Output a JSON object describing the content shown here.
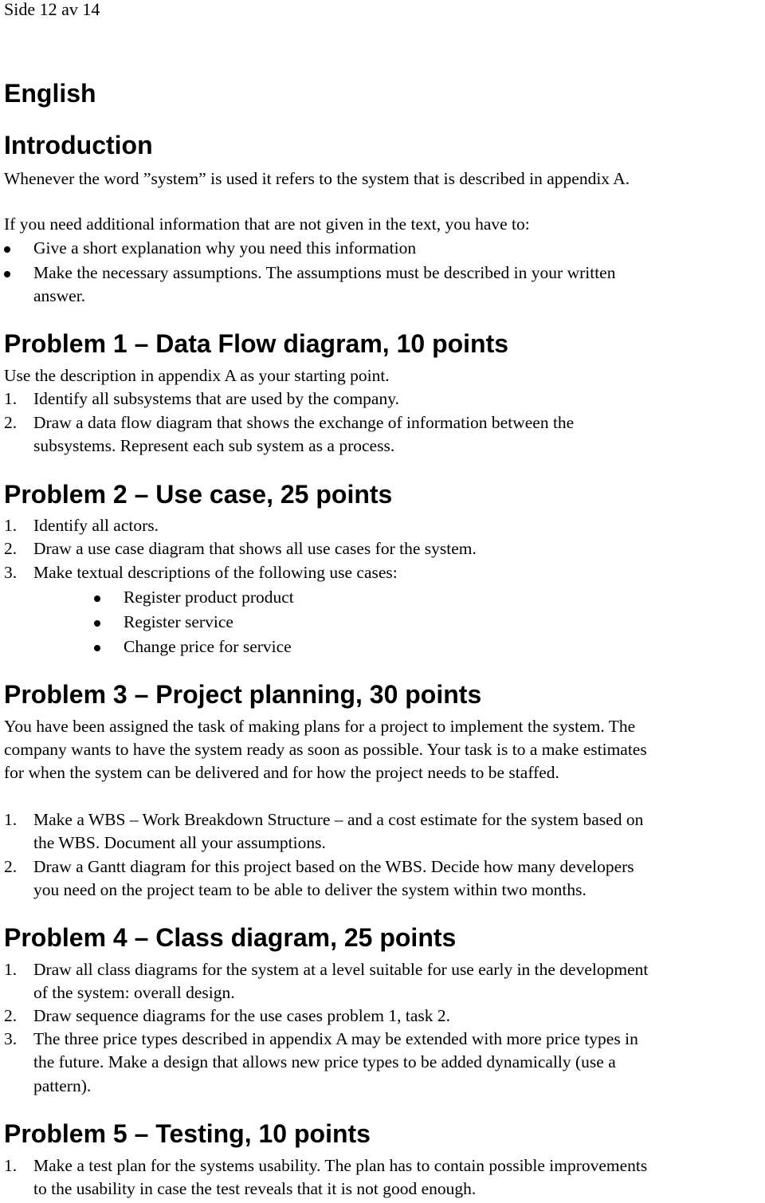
{
  "page_header": "Side 12 av 14",
  "language_heading": "English",
  "introduction": {
    "heading": "Introduction",
    "paragraph1": "Whenever the word ”system” is used it refers to the system that is described in appendix A.",
    "paragraph2": "If you need additional information that are not given in the text, you have to:",
    "bullets": [
      {
        "line1": "Give a short explanation why you need this information"
      },
      {
        "line1": "Make the necessary assumptions. The assumptions must be described in your written",
        "line2": "answer."
      }
    ]
  },
  "problems": [
    {
      "heading": "Problem 1 – Data Flow diagram, 10 points",
      "intro": "Use the description in appendix A as your starting point.",
      "items": [
        {
          "marker": "1.",
          "line1": "Identify all subsystems that are used by the company."
        },
        {
          "marker": "2.",
          "line1": "Draw a data flow diagram that shows the exchange of information between the",
          "line2": "subsystems. Represent each sub system as a process."
        }
      ]
    },
    {
      "heading": "Problem 2 – Use case, 25 points",
      "items": [
        {
          "marker": "1.",
          "line1": "Identify all actors."
        },
        {
          "marker": "2.",
          "line1": "Draw a use case diagram that shows all use cases for the system."
        },
        {
          "marker": "3.",
          "line1": "Make textual descriptions of the following use cases:"
        }
      ],
      "sub_bullets": [
        "Register product product",
        "Register service",
        "Change price for service"
      ]
    },
    {
      "heading": "Problem 3 – Project planning, 30 points",
      "intro_lines": [
        "You have been assigned the task of making plans for a project to implement the system. The",
        "company wants to have the system ready as soon as possible. Your task is to a make estimates",
        "for when the system can be delivered and for how the project needs to be staffed."
      ],
      "items": [
        {
          "marker": "1.",
          "line1": "Make a WBS – Work Breakdown Structure – and a cost estimate for the system based on",
          "line2": "the WBS. Document all your assumptions."
        },
        {
          "marker": "2.",
          "line1": "Draw a Gantt diagram for this project based on the WBS. Decide how many developers",
          "line2": "you need on the project team to be able to deliver the system within two months."
        }
      ]
    },
    {
      "heading": "Problem 4 – Class diagram, 25 points",
      "items": [
        {
          "marker": "1.",
          "line1": "Draw all class diagrams for the system at a level suitable for use early in the development",
          "line2": "of the system: overall design."
        },
        {
          "marker": "2.",
          "line1": "Draw sequence diagrams for the use cases problem 1, task 2."
        },
        {
          "marker": "3.",
          "line1": "The three price types described in appendix A may be extended with more price types in",
          "line2": "the future. Make a design that allows new price types to be added dynamically (use a",
          "line3": "pattern)."
        }
      ]
    },
    {
      "heading": "Problem 5 – Testing, 10 points",
      "items": [
        {
          "marker": "1.",
          "line1": "Make a test plan for the systems usability. The plan has to contain possible improvements",
          "line2": "to the usability in case the test reveals that it is not good enough."
        }
      ]
    }
  ]
}
